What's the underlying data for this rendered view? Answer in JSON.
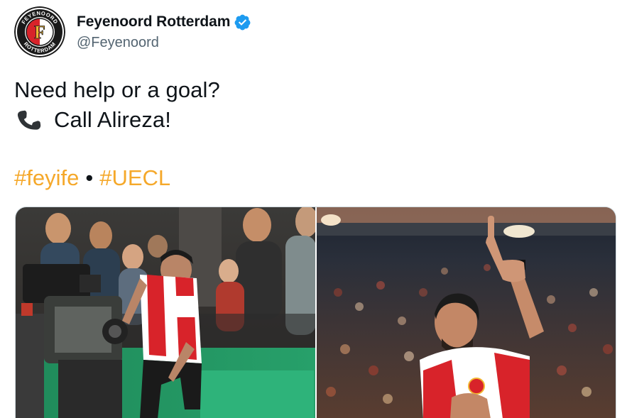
{
  "author": {
    "display_name": "Feyenoord Rotterdam",
    "handle": "@Feyenoord",
    "avatar_icon": "feyenoord-crest-icon",
    "verified_icon": "verified-badge-icon",
    "avatar_ring_text_top": "FEYENOORD",
    "avatar_ring_text_bottom": "ROTTERDAM",
    "avatar_letter": "F"
  },
  "tweet": {
    "line1": "Need help or a goal?",
    "line2_emoji": "phone-receiver-icon",
    "line2": "Call Alireza!",
    "hashtag1": "#feyife",
    "separator": "•",
    "hashtag2": "#UECL"
  },
  "media": {
    "photos": [
      {
        "subject": "player-with-tv-camera"
      },
      {
        "subject": "player-pointing-up"
      }
    ]
  },
  "colors": {
    "hashtag": "#f5a82a",
    "verified": "#1d9bf0",
    "handle": "#536471",
    "text": "#0f1419",
    "kit_red": "#d8232a"
  }
}
